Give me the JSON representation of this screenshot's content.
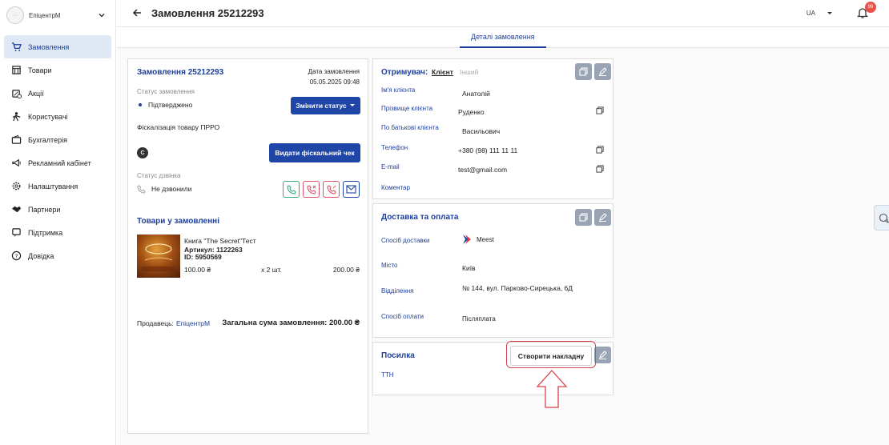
{
  "sidebar": {
    "brand_name": "ЕпіцентрМ",
    "items": [
      {
        "label": "Замовлення",
        "icon": "cart-icon"
      },
      {
        "label": "Товари",
        "icon": "store-icon"
      },
      {
        "label": "Акції",
        "icon": "discount-icon"
      },
      {
        "label": "Користувачі",
        "icon": "users-icon"
      },
      {
        "label": "Бухгалтерія",
        "icon": "wallet-icon"
      },
      {
        "label": "Рекламний кабінет",
        "icon": "megaphone-icon"
      },
      {
        "label": "Налаштування",
        "icon": "gear-icon"
      },
      {
        "label": "Партнери",
        "icon": "handshake-icon"
      },
      {
        "label": "Підтримка",
        "icon": "support-icon"
      },
      {
        "label": "Довідка",
        "icon": "help-icon"
      }
    ]
  },
  "header": {
    "title": "Замовлення 25212293",
    "lang": "UA",
    "notifications": "99"
  },
  "tabs": {
    "details": "Деталі замовлення"
  },
  "order": {
    "title": "Замовлення 25212293",
    "date_label": "Дата замовлення",
    "date_value": "05.05.2025 09:48",
    "status_label": "Статус замовлення",
    "status_value": "Підтверджено",
    "change_status": "Змінити статус",
    "fiscal_label": "Фіскалізація товару ПРРО",
    "fiscal_badge": "С",
    "fiscal_button": "Видати фіскальний чек",
    "call_status_label": "Статус дзвінка",
    "call_status_value": "Не дзвонили",
    "products_title": "Товари у замовленні",
    "product": {
      "name": "Книга \"The Secret\"Тест",
      "article": "Артикул: 1122263",
      "id": "ID: 5950569",
      "price": "100.00 ₴",
      "qty": "х 2 шт.",
      "total": "200.00 ₴"
    },
    "seller_label": "Продавець:",
    "seller_value": "ЕпіцентрМ",
    "total_label": "Загальна сума замовлення: 200.00 ₴"
  },
  "recipient": {
    "title": "Отримувач:",
    "tab_client": "Клієнт",
    "tab_other": "Інший",
    "fields": [
      {
        "label": "Ім'я клієнта",
        "value": "Анатолій"
      },
      {
        "label": "Прізвище клієнта",
        "value": "Руденко"
      },
      {
        "label": "По батькові клієнта",
        "value": "Васильович"
      },
      {
        "label": "Телефон",
        "value": "+380 (98) 111 11 11"
      },
      {
        "label": "E-mail",
        "value": "test@gmail.com"
      },
      {
        "label": "Коментар",
        "value": ""
      }
    ]
  },
  "delivery": {
    "title": "Доставка та оплата",
    "method_label": "Спосіб доставки",
    "method_value": "Meest",
    "city_label": "Місто",
    "city_value": "Київ",
    "branch_label": "Відділення",
    "branch_value": "№ 144, вул. Парково-Сирецька, 6Д",
    "payment_label": "Спосіб оплати",
    "payment_value": "Післяплата"
  },
  "parcel": {
    "title": "Посилка",
    "ttn_label": "ТТН",
    "create_button": "Створити накладну"
  },
  "colors": {
    "primary": "#1f45a6",
    "highlight": "#d8434b",
    "status_dot": "#1d3f9a",
    "call_green": "#3aa981",
    "call_red": "#d9506a"
  }
}
